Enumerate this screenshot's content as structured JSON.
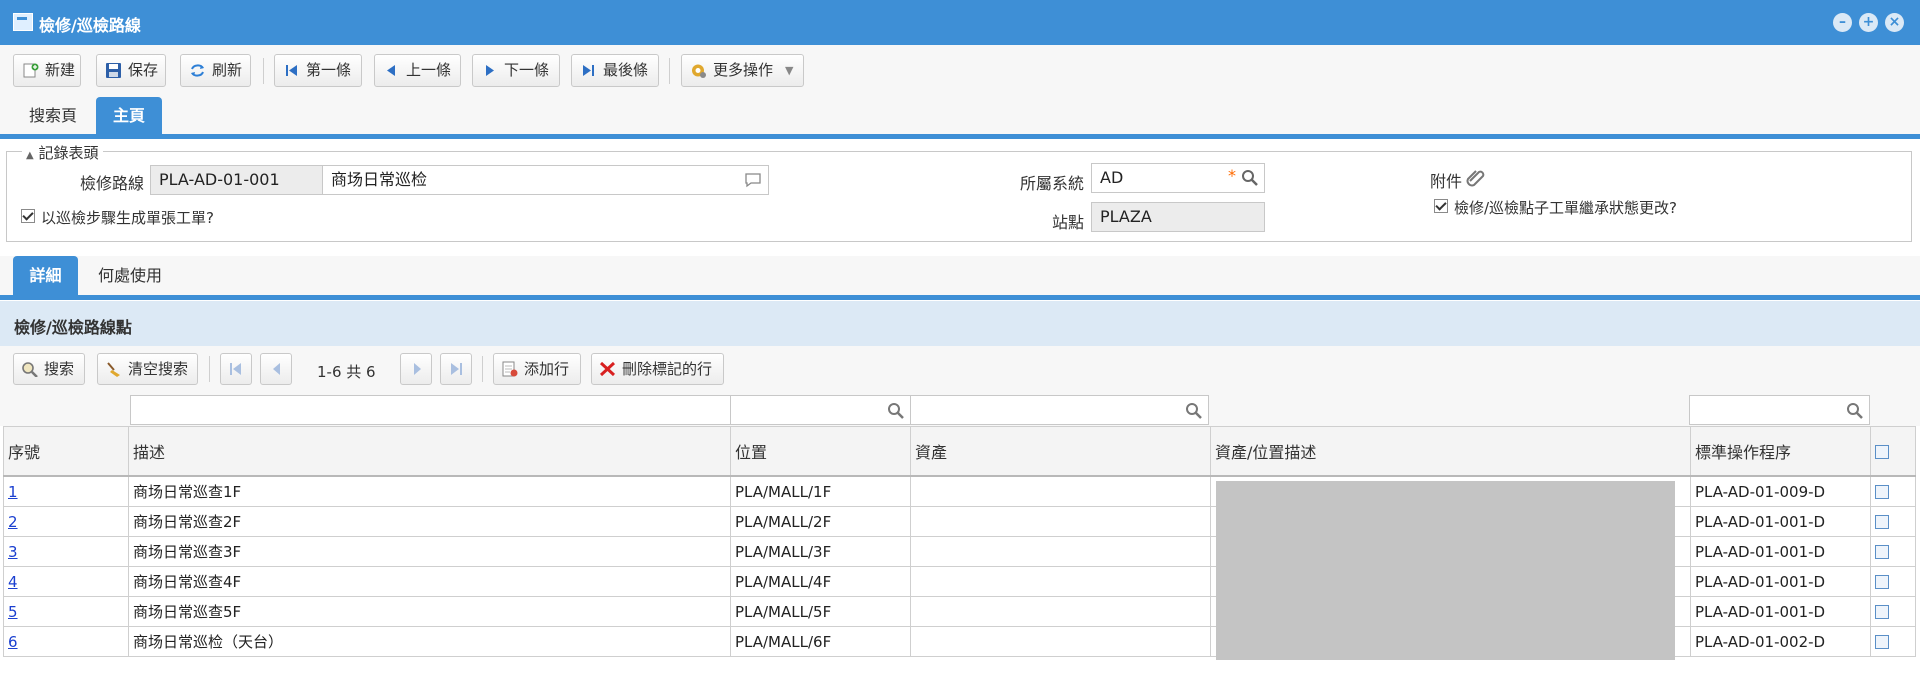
{
  "window": {
    "title": "檢修/巡檢路線"
  },
  "toolbar": {
    "new": "新建",
    "save": "保存",
    "refresh": "刷新",
    "first": "第一條",
    "prev": "上一條",
    "next": "下一條",
    "last": "最後條",
    "more": "更多操作"
  },
  "tabs_main": [
    "搜索頁",
    "主頁"
  ],
  "header": {
    "legend": "記錄表頭",
    "route_label": "檢修路線",
    "route_code": "PLA-AD-01-001",
    "route_desc": "商场日常巡检",
    "system_label": "所屬系統",
    "system_value": "AD",
    "site_label": "站點",
    "site_value": "PLAZA",
    "attach_label": "附件",
    "chk1_label": "以巡檢步驟生成單張工單?",
    "chk2_label": "檢修/巡檢點子工單繼承狀態更改?"
  },
  "tabs_detail": [
    "詳細",
    "何處使用"
  ],
  "section": {
    "title": "檢修/巡檢路線點",
    "search": "搜索",
    "clear": "清空搜索",
    "page_info": "1-6 共 6",
    "add_row": "添加行",
    "delete_marked": "刪除標記的行"
  },
  "table": {
    "headers": [
      "序號",
      "描述",
      "位置",
      "資產",
      "資產/位置描述",
      "標準操作程序"
    ],
    "rows": [
      {
        "no": "1",
        "desc": "商场日常巡查1F",
        "loc": "PLA/MALL/1F",
        "asset": "",
        "sop": "PLA-AD-01-009-D"
      },
      {
        "no": "2",
        "desc": "商场日常巡查2F",
        "loc": "PLA/MALL/2F",
        "asset": "",
        "sop": "PLA-AD-01-001-D"
      },
      {
        "no": "3",
        "desc": "商场日常巡查3F",
        "loc": "PLA/MALL/3F",
        "asset": "",
        "sop": "PLA-AD-01-001-D"
      },
      {
        "no": "4",
        "desc": "商场日常巡查4F",
        "loc": "PLA/MALL/4F",
        "asset": "",
        "sop": "PLA-AD-01-001-D"
      },
      {
        "no": "5",
        "desc": "商场日常巡查5F",
        "loc": "PLA/MALL/5F",
        "asset": "",
        "sop": "PLA-AD-01-001-D"
      },
      {
        "no": "6",
        "desc": "商场日常巡检（天台）",
        "loc": "PLA/MALL/6F",
        "asset": "",
        "sop": "PLA-AD-01-002-D"
      }
    ]
  },
  "colors": {
    "accent": "#3e8fd6",
    "section_bg": "#dce9f5",
    "required": "#ff6a00"
  }
}
